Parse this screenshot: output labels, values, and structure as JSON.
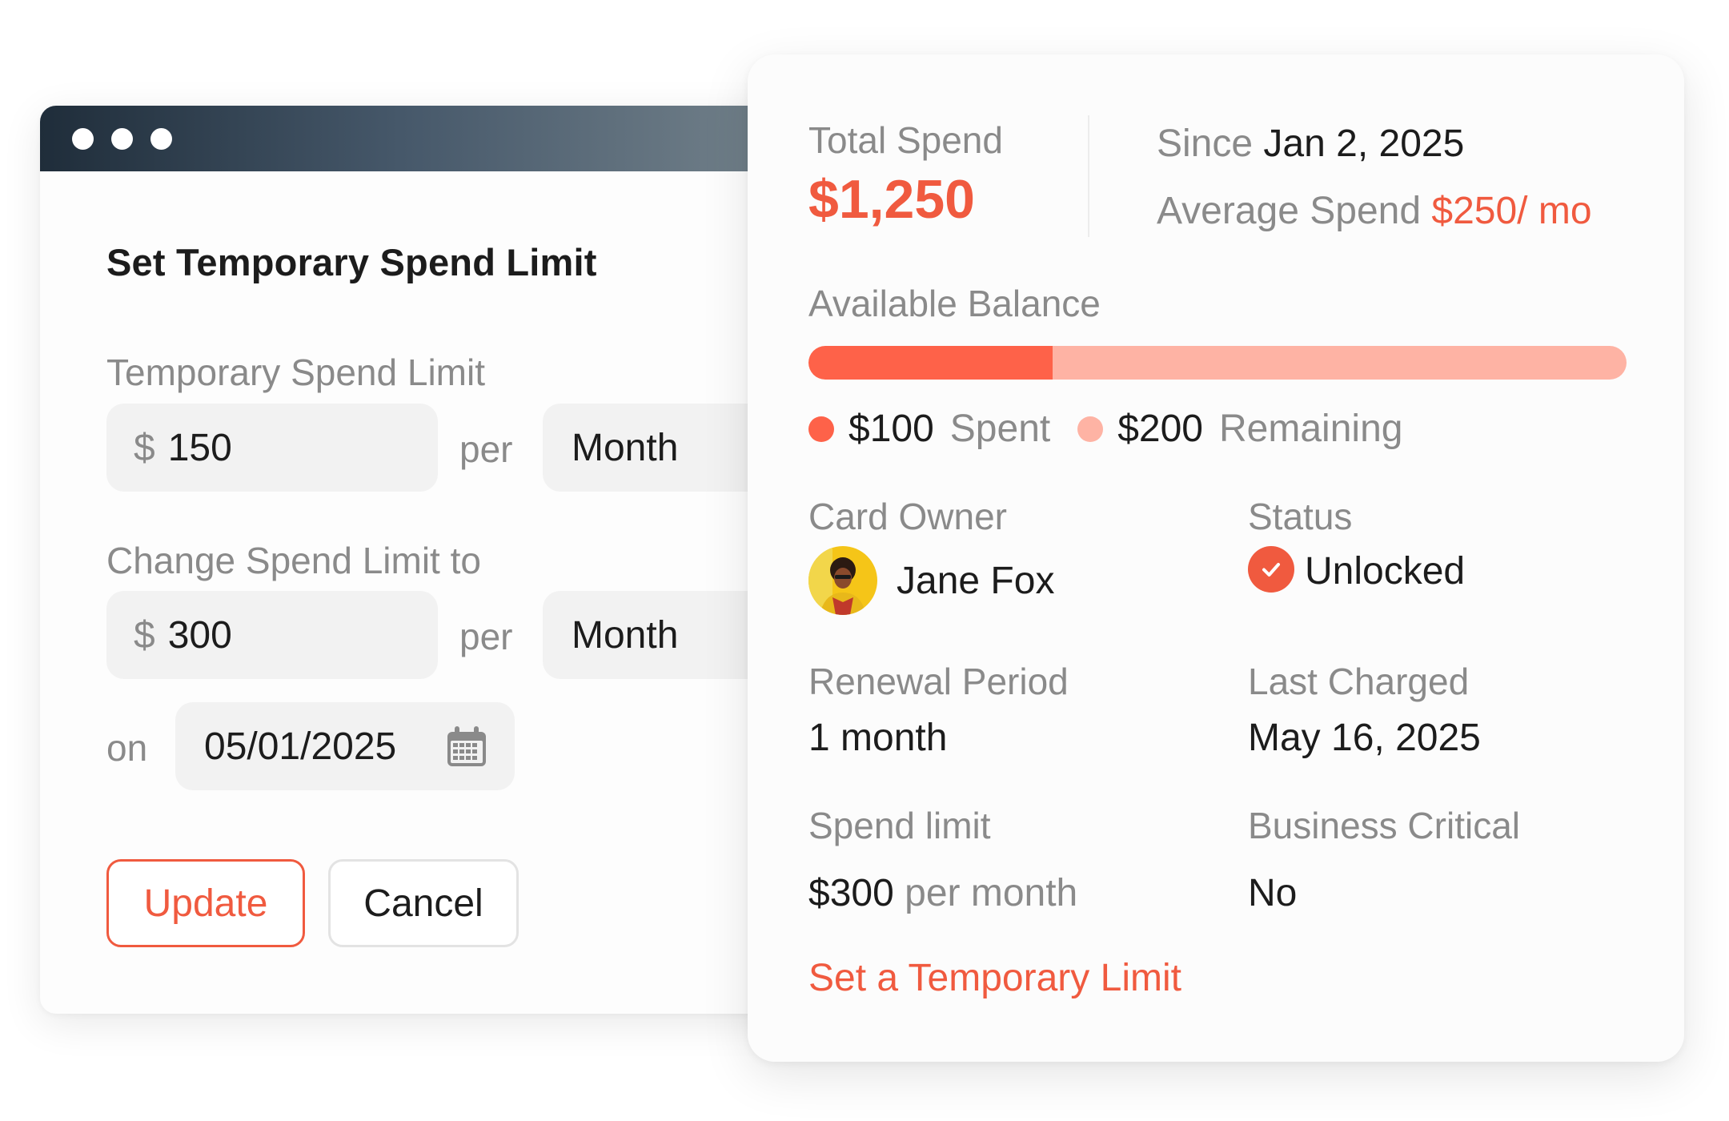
{
  "limit_form": {
    "title": "Set Temporary Spend Limit",
    "temporary_label": "Temporary Spend Limit",
    "currency_symbol": "$",
    "temporary_value": "150",
    "per_text": "per",
    "temporary_period": "Month",
    "change_label": "Change Spend Limit to",
    "change_value": "300",
    "change_period": "Month",
    "on_text": "on",
    "date_value": "05/01/2025",
    "update_label": "Update",
    "cancel_label": "Cancel"
  },
  "summary": {
    "total_spend_label": "Total Spend",
    "total_spend_value": "$1,250",
    "since_label": "Since",
    "since_value": "Jan 2, 2025",
    "avg_label": "Average Spend",
    "avg_value": "$250/ mo",
    "balance_label": "Available Balance",
    "spent_fraction": 0.2985,
    "spent_amount": "$100",
    "spent_text": "Spent",
    "remaining_amount": "$200",
    "remaining_text": "Remaining",
    "card_owner_label": "Card Owner",
    "card_owner_name": "Jane Fox",
    "status_label": "Status",
    "status_value": "Unlocked",
    "renewal_label": "Renewal Period",
    "renewal_value": "1 month",
    "last_charged_label": "Last Charged",
    "last_charged_value": "May 16, 2025",
    "spend_limit_label": "Spend limit",
    "spend_limit_amount": "$300",
    "spend_limit_unit": "per month",
    "business_critical_label": "Business Critical",
    "business_critical_value": "No",
    "temp_limit_link": "Set a Temporary Limit"
  },
  "colors": {
    "accent": "#f05a3f",
    "bar_spent": "#fe6249",
    "bar_remaining": "#feb3a4",
    "titlebar_start": "#1f2d3a",
    "titlebar_end": "#7a8890"
  },
  "icons": {
    "window_dots": [
      "window-dot-icon",
      "window-dot-icon",
      "window-dot-icon"
    ],
    "calendar": "calendar-icon",
    "status": "check-circle-icon",
    "owner": "avatar"
  }
}
